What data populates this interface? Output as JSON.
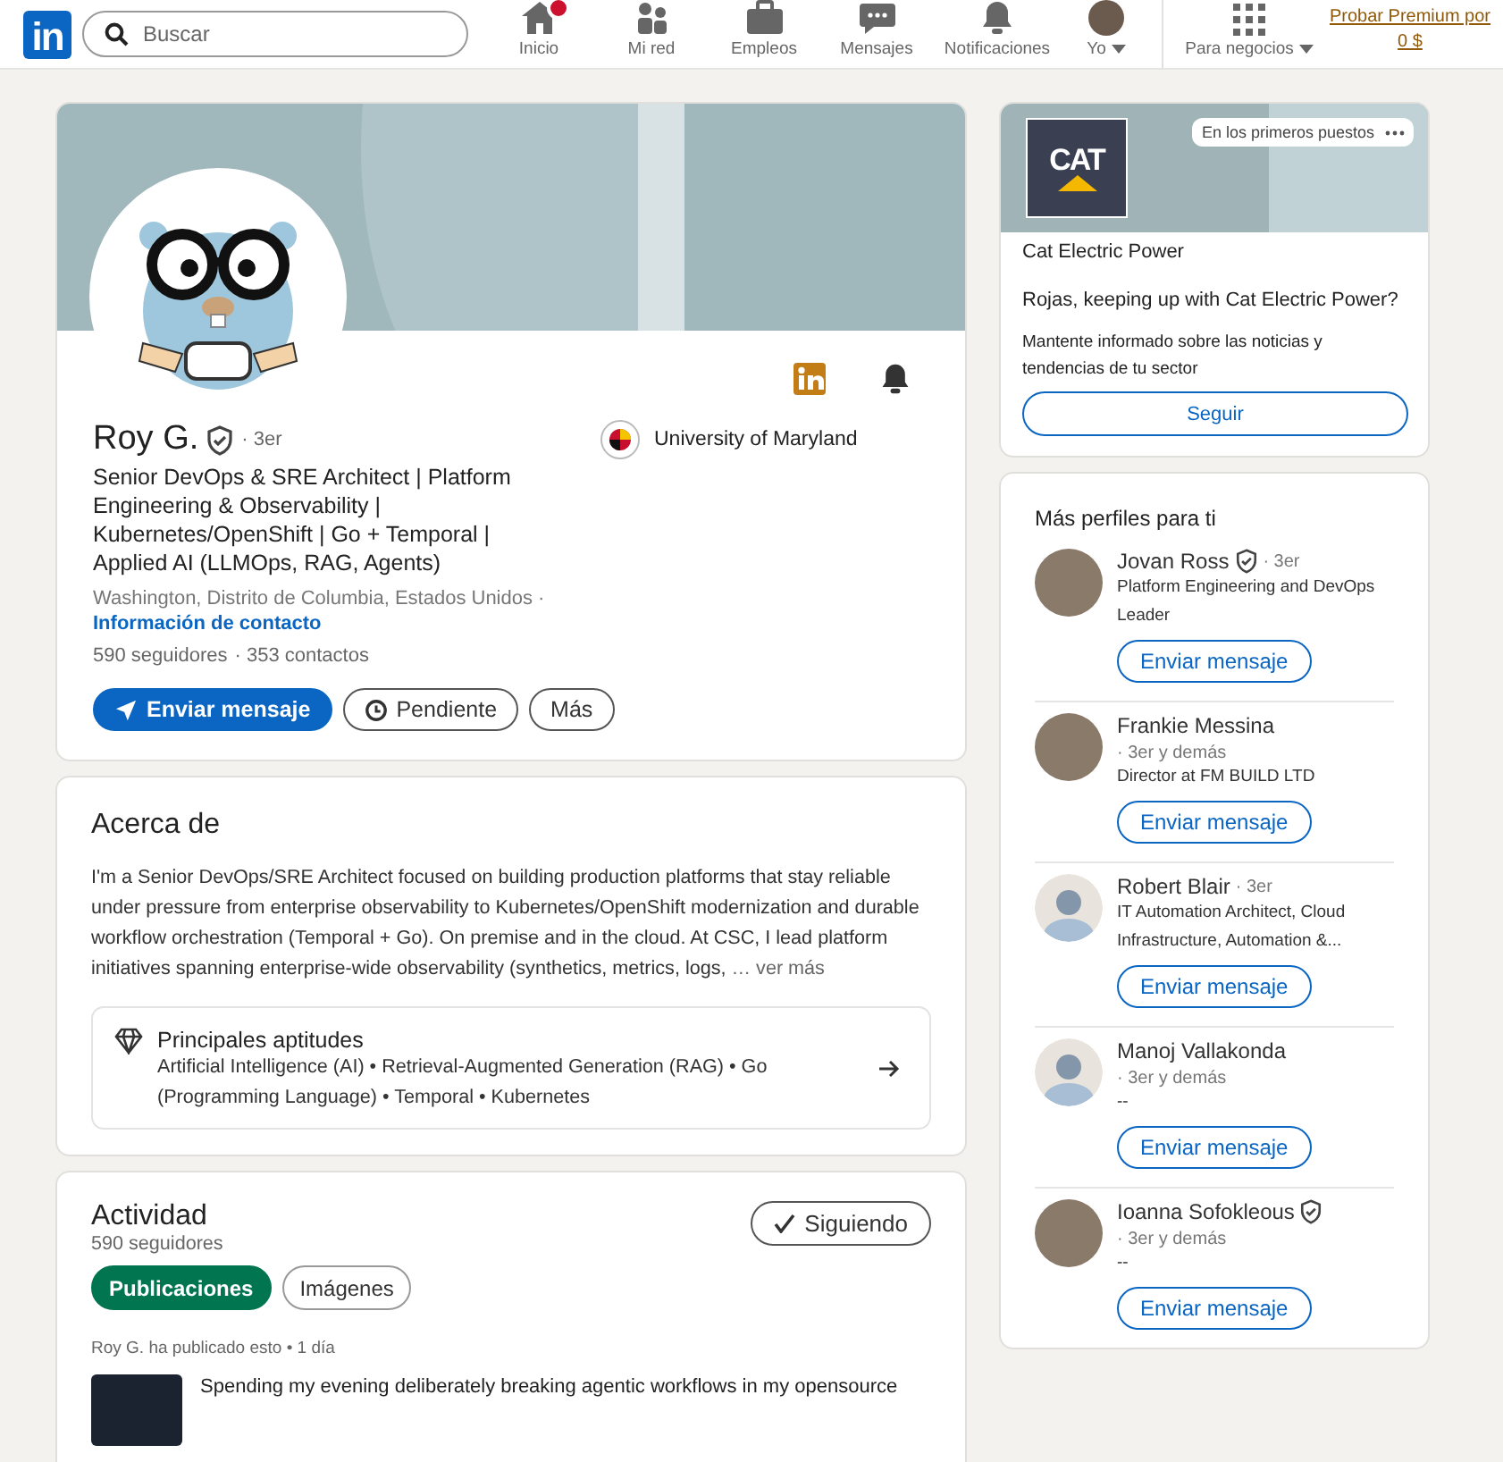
{
  "header": {
    "logo": "in",
    "search": {
      "placeholder": "Buscar"
    },
    "nav": [
      {
        "kind": "home",
        "label": "Inicio",
        "badge": true
      },
      {
        "kind": "network",
        "label": "Mi red",
        "badge": false
      },
      {
        "kind": "jobs",
        "label": "Empleos",
        "badge": false
      },
      {
        "kind": "messages",
        "label": "Mensajes",
        "badge": false
      },
      {
        "kind": "bell",
        "label": "Notificaciones",
        "badge": false
      },
      {
        "kind": "me",
        "label": "Yo",
        "badge": false
      },
      {
        "kind": "business",
        "label": "Para negocios",
        "badge": false
      }
    ],
    "premium": "Probar Premium por 0 $"
  },
  "profile": {
    "name": "Roy G.",
    "verified": true,
    "degree": "· 3er",
    "headline": "Senior DevOps & SRE Architect | Platform Engineering & Observability | Kubernetes/OpenShift | Go + Temporal | Applied AI (LLMOps, RAG, Agents)",
    "school": "University of Maryland",
    "location": "Washington, Distrito de Columbia, Estados Unidos ·",
    "contact": "Información de contacto",
    "followers": "590 seguidores",
    "connections": "· 353 contactos",
    "buttons": [
      {
        "kind": "primary",
        "label": "Enviar mensaje"
      },
      {
        "kind": "pending",
        "label": "Pendiente"
      },
      {
        "kind": "plain",
        "label": "Más"
      }
    ]
  },
  "about": {
    "title": "Acerca de",
    "text": "I'm a Senior DevOps/SRE Architect focused on building production platforms that stay reliable under pressure from enterprise observability to Kubernetes/OpenShift modernization and durable workflow orchestration (Temporal + Go). On premise and in the cloud. At CSC, I lead platform initiatives spanning enterprise-wide observability (synthetics, metrics, logs,",
    "see_more": "… ver más",
    "skills_title": "Principales aptitudes",
    "skills": "Artificial Intelligence (AI) • Retrieval-Augmented Generation (RAG) • Go (Programming Language) • Temporal • Kubernetes"
  },
  "activity": {
    "title": "Actividad",
    "followers": "590 seguidores",
    "follow_button": "Siguiendo",
    "tabs": [
      {
        "label": "Publicaciones",
        "selected": true
      },
      {
        "label": "Imágenes",
        "selected": false
      }
    ],
    "post_meta": "Roy G. ha publicado esto • 1 día",
    "post_text": "Spending my evening deliberately breaking agentic workflows in my opensource"
  },
  "promo": {
    "badge": "En los primeros puestos",
    "logo_text": "CAT",
    "company": "Cat Electric Power",
    "question": "Rojas, keeping up with Cat Electric Power?",
    "description": "Mantente informado sobre las noticias y tendencias de tu sector",
    "button": "Seguir"
  },
  "suggestions": {
    "title": "Más perfiles para ti",
    "profiles": [
      {
        "name": "Jovan Ross",
        "verified": true,
        "degree": "· 3er",
        "headline": "Platform Engineering and DevOps Leader",
        "kind": "photo",
        "button": "Enviar mensaje"
      },
      {
        "name": "Frankie Messina",
        "verified": false,
        "degree": "· 3er y demás",
        "headline": "Director at FM BUILD LTD",
        "kind": "photo",
        "button": "Enviar mensaje"
      },
      {
        "name": "Robert Blair",
        "verified": false,
        "degree": "· 3er",
        "headline": "IT Automation Architect, Cloud Infrastructure, Automation &...",
        "kind": "silhouette",
        "button": "Enviar mensaje"
      },
      {
        "name": "Manoj Vallakonda",
        "verified": false,
        "degree": "· 3er y demás",
        "headline": "--",
        "kind": "silhouette",
        "button": "Enviar mensaje"
      },
      {
        "name": "Ioanna Sofokleous",
        "verified": true,
        "degree": "· 3er y demás",
        "headline": "--",
        "kind": "photo",
        "button": "Enviar mensaje"
      }
    ]
  }
}
